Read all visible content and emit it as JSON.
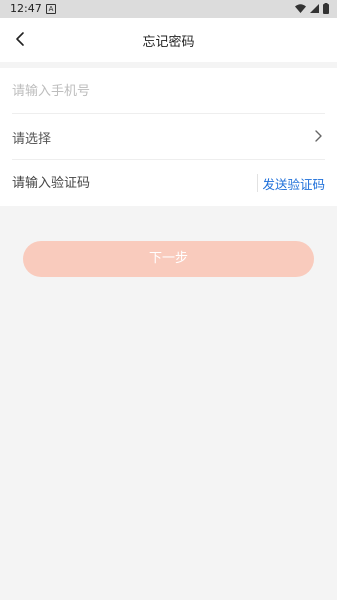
{
  "status_bar": {
    "time": "12:47",
    "notification_icon": "a-icon",
    "a_icon_text": "A",
    "right_icons": [
      "wifi-icon",
      "signal-icon",
      "battery-icon"
    ]
  },
  "header": {
    "back_icon": "chevron-left-icon",
    "title": "忘记密码"
  },
  "form": {
    "phone": {
      "placeholder": "请输入手机号",
      "value": ""
    },
    "select": {
      "label": "请选择",
      "icon": "chevron-right-icon"
    },
    "code": {
      "placeholder": "请输入验证码",
      "value": "",
      "send_label": "发送验证码"
    }
  },
  "next_button": {
    "label": "下一步"
  },
  "colors": {
    "background": "#f4f4f4",
    "card": "#ffffff",
    "accent_link": "#1e6fd9",
    "button_fill": "#f9cbbd",
    "button_text": "#ffffff",
    "placeholder": "#bdbdbd"
  }
}
